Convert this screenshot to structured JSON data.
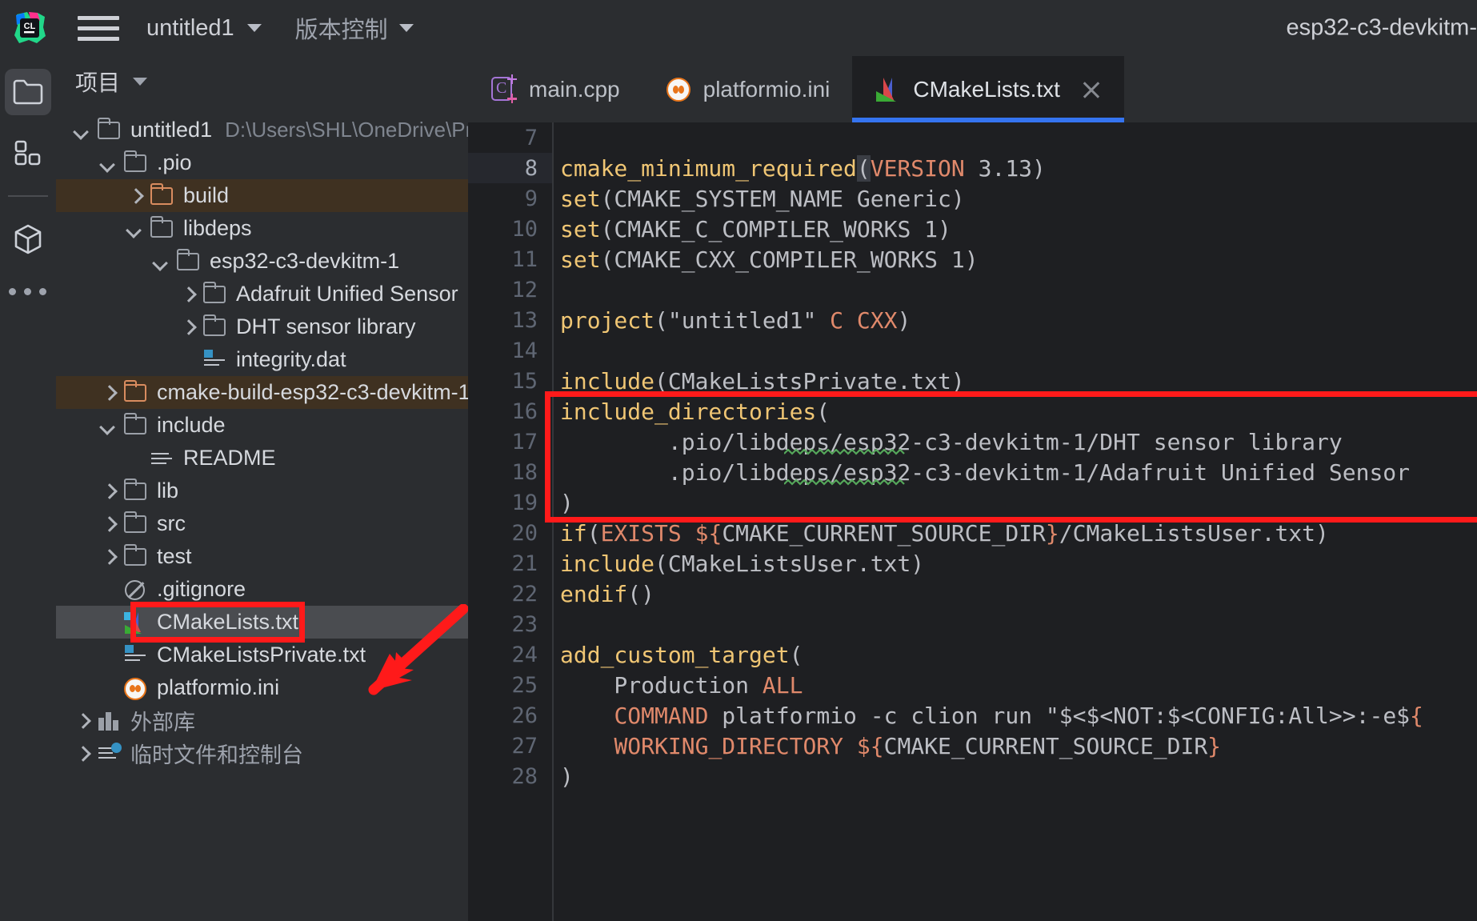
{
  "titlebar": {
    "app_icon": "clion-logo-icon",
    "menu_icon": "hamburger-menu-icon",
    "project_name": "untitled1",
    "vcs_label": "版本控制",
    "run_configuration": "esp32-c3-devkitm-"
  },
  "toolstrip": {
    "items": [
      {
        "name": "project-tool-window",
        "icon": "folder-icon",
        "active": true
      },
      {
        "name": "structure-tool-window",
        "icon": "grid-modules-icon",
        "active": false
      },
      {
        "name": "cmake-tool-window",
        "icon": "cube-icon",
        "active": false
      },
      {
        "name": "more-tool-windows",
        "icon": "ellipsis-icon",
        "active": false
      }
    ]
  },
  "project_panel": {
    "title": "项目",
    "tree": [
      {
        "depth": 0,
        "arrow": "down",
        "icon": "folder-icon",
        "label": "untitled1",
        "path": "D:\\Users\\SHL\\OneDrive\\Projec",
        "state": "normal"
      },
      {
        "depth": 1,
        "arrow": "down",
        "icon": "folder-icon",
        "label": ".pio",
        "path": "",
        "state": "normal"
      },
      {
        "depth": 2,
        "arrow": "right",
        "icon": "folder-orange-icon",
        "label": "build",
        "path": "",
        "state": "excluded"
      },
      {
        "depth": 2,
        "arrow": "down",
        "icon": "folder-icon",
        "label": "libdeps",
        "path": "",
        "state": "normal"
      },
      {
        "depth": 3,
        "arrow": "down",
        "icon": "folder-icon",
        "label": "esp32-c3-devkitm-1",
        "path": "",
        "state": "normal"
      },
      {
        "depth": 4,
        "arrow": "right",
        "icon": "folder-icon",
        "label": "Adafruit Unified Sensor",
        "path": "",
        "state": "normal"
      },
      {
        "depth": 4,
        "arrow": "right",
        "icon": "folder-icon",
        "label": "DHT sensor library",
        "path": "",
        "state": "normal"
      },
      {
        "depth": 4,
        "arrow": "none",
        "icon": "text-file-icon",
        "label": "integrity.dat",
        "path": "",
        "state": "normal"
      },
      {
        "depth": 1,
        "arrow": "right",
        "icon": "folder-orange-icon",
        "label": "cmake-build-esp32-c3-devkitm-1",
        "path": "",
        "state": "excluded"
      },
      {
        "depth": 1,
        "arrow": "down",
        "icon": "folder-icon",
        "label": "include",
        "path": "",
        "state": "normal"
      },
      {
        "depth": 2,
        "arrow": "none",
        "icon": "plain-file-icon",
        "label": "README",
        "path": "",
        "state": "normal"
      },
      {
        "depth": 1,
        "arrow": "right",
        "icon": "folder-icon",
        "label": "lib",
        "path": "",
        "state": "normal"
      },
      {
        "depth": 1,
        "arrow": "right",
        "icon": "folder-icon",
        "label": "src",
        "path": "",
        "state": "normal"
      },
      {
        "depth": 1,
        "arrow": "right",
        "icon": "folder-icon",
        "label": "test",
        "path": "",
        "state": "normal"
      },
      {
        "depth": 1,
        "arrow": "none",
        "icon": "gitignore-icon",
        "label": ".gitignore",
        "path": "",
        "state": "normal"
      },
      {
        "depth": 1,
        "arrow": "none",
        "icon": "cmake-icon",
        "label": "CMakeLists.txt",
        "path": "",
        "state": "selected"
      },
      {
        "depth": 1,
        "arrow": "none",
        "icon": "text-file-icon",
        "label": "CMakeListsPrivate.txt",
        "path": "",
        "state": "normal"
      },
      {
        "depth": 1,
        "arrow": "none",
        "icon": "platformio-icon",
        "label": "platformio.ini",
        "path": "",
        "state": "normal"
      },
      {
        "depth": 0,
        "arrow": "right",
        "icon": "external-libraries-icon",
        "label": "外部库",
        "path": "",
        "state": "dim"
      },
      {
        "depth": 0,
        "arrow": "right",
        "icon": "scratches-icon",
        "label": "临时文件和控制台",
        "path": "",
        "state": "dim"
      }
    ]
  },
  "editor": {
    "tabs": [
      {
        "label": "main.cpp",
        "icon": "cpp-file-icon",
        "active": false,
        "closable": false
      },
      {
        "label": "platformio.ini",
        "icon": "platformio-icon",
        "active": false,
        "closable": false
      },
      {
        "label": "CMakeLists.txt",
        "icon": "cmake-icon",
        "active": true,
        "closable": true
      }
    ],
    "close_icon": "close-icon",
    "first_line_number": 7,
    "current_line": 8,
    "lines": [
      {
        "n": 7,
        "tokens": []
      },
      {
        "n": 8,
        "tokens": [
          {
            "t": "cmake_minimum_required",
            "c": "fn"
          },
          {
            "t": "(",
            "c": "caret"
          },
          {
            "t": "VERSION",
            "c": "kw"
          },
          {
            "t": " 3.13",
            "c": "pn"
          },
          {
            "t": ")",
            "c": "pn"
          }
        ]
      },
      {
        "n": 9,
        "tokens": [
          {
            "t": "set",
            "c": "fn"
          },
          {
            "t": "(CMAKE_SYSTEM_NAME Generic)",
            "c": "pn"
          }
        ]
      },
      {
        "n": 10,
        "tokens": [
          {
            "t": "set",
            "c": "fn"
          },
          {
            "t": "(CMAKE_C_COMPILER_WORKS 1)",
            "c": "pn"
          }
        ]
      },
      {
        "n": 11,
        "tokens": [
          {
            "t": "set",
            "c": "fn"
          },
          {
            "t": "(CMAKE_CXX_COMPILER_WORKS 1)",
            "c": "pn"
          }
        ]
      },
      {
        "n": 12,
        "tokens": []
      },
      {
        "n": 13,
        "tokens": [
          {
            "t": "project",
            "c": "fn"
          },
          {
            "t": "(\"untitled1\" ",
            "c": "pn"
          },
          {
            "t": "C CXX",
            "c": "kw"
          },
          {
            "t": ")",
            "c": "pn"
          }
        ]
      },
      {
        "n": 14,
        "tokens": []
      },
      {
        "n": 15,
        "tokens": [
          {
            "t": "include",
            "c": "fn"
          },
          {
            "t": "(CMakeListsPrivate.txt)",
            "c": "pn"
          }
        ]
      },
      {
        "n": 16,
        "tokens": [
          {
            "t": "include_directories",
            "c": "fn"
          },
          {
            "t": "(",
            "c": "pn"
          }
        ]
      },
      {
        "n": 17,
        "tokens": [
          {
            "t": "        .pio/libdeps/esp32-c3-devkitm-1/DHT sensor library",
            "c": "pn"
          }
        ]
      },
      {
        "n": 18,
        "tokens": [
          {
            "t": "        .pio/libdeps/esp32-c3-devkitm-1/Adafruit Unified Sensor",
            "c": "pn"
          }
        ]
      },
      {
        "n": 19,
        "tokens": [
          {
            "t": ")",
            "c": "pn"
          }
        ]
      },
      {
        "n": 20,
        "tokens": [
          {
            "t": "if",
            "c": "fn"
          },
          {
            "t": "(",
            "c": "pn"
          },
          {
            "t": "EXISTS",
            "c": "kw"
          },
          {
            "t": " ",
            "c": "pn"
          },
          {
            "t": "${",
            "c": "var"
          },
          {
            "t": "CMAKE_CURRENT_SOURCE_DIR",
            "c": "pn"
          },
          {
            "t": "}",
            "c": "var"
          },
          {
            "t": "/CMakeListsUser.txt)",
            "c": "pn"
          }
        ]
      },
      {
        "n": 21,
        "tokens": [
          {
            "t": "include",
            "c": "fn"
          },
          {
            "t": "(CMakeListsUser.txt)",
            "c": "pn"
          }
        ]
      },
      {
        "n": 22,
        "tokens": [
          {
            "t": "endif",
            "c": "fn"
          },
          {
            "t": "()",
            "c": "pn"
          }
        ]
      },
      {
        "n": 23,
        "tokens": []
      },
      {
        "n": 24,
        "tokens": [
          {
            "t": "add_custom_target",
            "c": "fn"
          },
          {
            "t": "(",
            "c": "pn"
          }
        ]
      },
      {
        "n": 25,
        "tokens": [
          {
            "t": "    Production ",
            "c": "pn"
          },
          {
            "t": "ALL",
            "c": "kw"
          }
        ]
      },
      {
        "n": 26,
        "tokens": [
          {
            "t": "    ",
            "c": "pn"
          },
          {
            "t": "COMMAND",
            "c": "kw"
          },
          {
            "t": " platformio -c clion run \"$<$<NOT:$<CONFIG:All>>:-e$",
            "c": "pn"
          },
          {
            "t": "{",
            "c": "var"
          }
        ]
      },
      {
        "n": 27,
        "tokens": [
          {
            "t": "    ",
            "c": "pn"
          },
          {
            "t": "WORKING_DIRECTORY",
            "c": "kw"
          },
          {
            "t": " ",
            "c": "pn"
          },
          {
            "t": "${",
            "c": "var"
          },
          {
            "t": "CMAKE_CURRENT_SOURCE_DIR",
            "c": "pn"
          },
          {
            "t": "}",
            "c": "var"
          }
        ]
      },
      {
        "n": 28,
        "tokens": [
          {
            "t": ")",
            "c": "pn"
          }
        ]
      }
    ],
    "spellcheck_word": "devkitm"
  },
  "annotations": {
    "highlight_color": "#ff1a1a",
    "code_box": {
      "lines": "16-19",
      "note": "red rectangle around include_directories block"
    },
    "tree_box": {
      "target": "CMakeLists.txt",
      "note": "red rectangle around CMakeLists.txt tree item"
    },
    "arrow": {
      "points_to": "CMakeLists.txt",
      "note": "red arrow pointing down-left at CMakeLists.txt"
    }
  }
}
